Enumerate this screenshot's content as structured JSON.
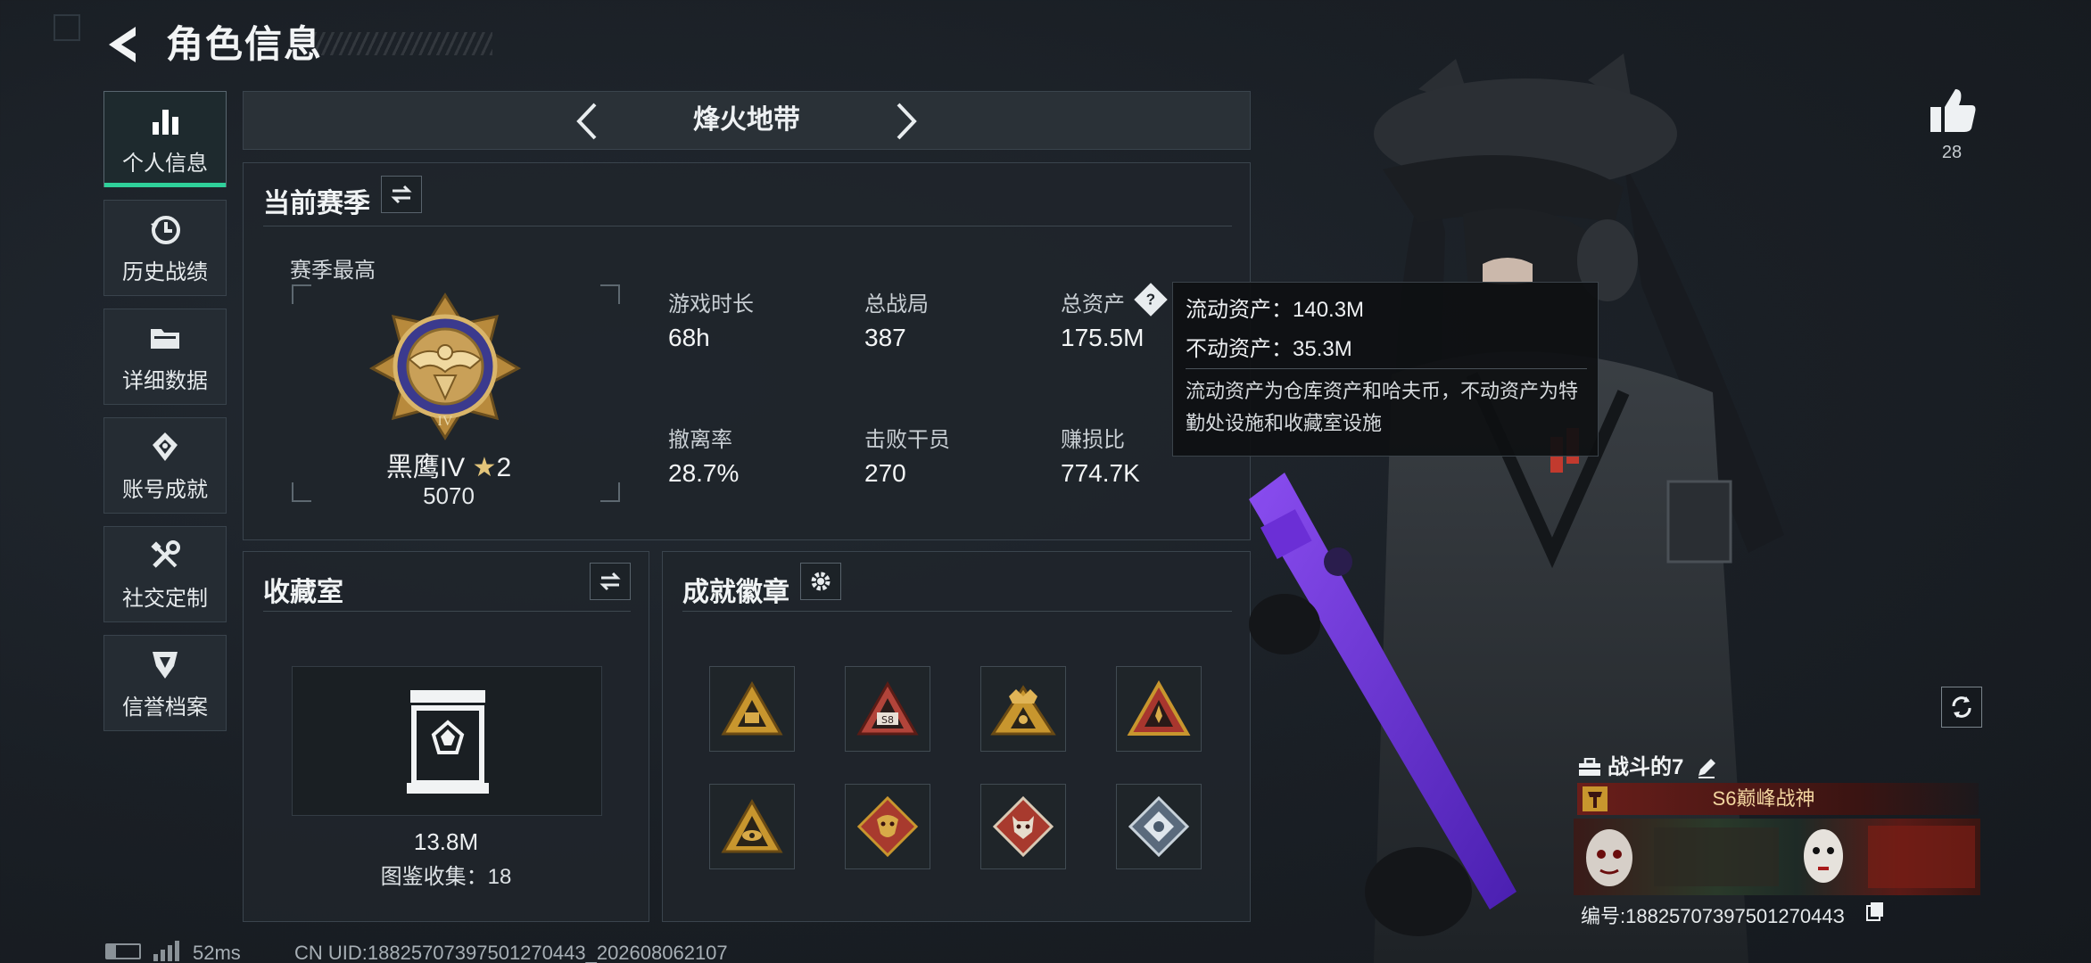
{
  "header": {
    "title": "角色信息"
  },
  "sidebar": {
    "items": [
      {
        "label": "个人信息",
        "icon": "bar-chart-icon",
        "active": true
      },
      {
        "label": "历史战绩",
        "icon": "history-clock-icon"
      },
      {
        "label": "详细数据",
        "icon": "folder-icon"
      },
      {
        "label": "账号成就",
        "icon": "achievement-icon"
      },
      {
        "label": "社交定制",
        "icon": "tools-icon"
      },
      {
        "label": "信誉档案",
        "icon": "credit-shield-icon"
      }
    ]
  },
  "mode": {
    "title": "烽火地带"
  },
  "season": {
    "title": "当前赛季",
    "best_label": "赛季最高",
    "rank_name": "黑鹰IV",
    "rank_star": "★",
    "rank_stars": "2",
    "rank_score": "5070",
    "stats": [
      {
        "label": "游戏时长",
        "value": "68h"
      },
      {
        "label": "总战局",
        "value": "387"
      },
      {
        "label": "总资产",
        "value": "175.5M"
      },
      {
        "label": "撤离率",
        "value": "28.7%"
      },
      {
        "label": "击败干员",
        "value": "270"
      },
      {
        "label": "赚损比",
        "value": "774.7K"
      }
    ],
    "help_icon": "?"
  },
  "tooltip": {
    "liquid": "流动资产：140.3M",
    "fixed": "不动资产：35.3M",
    "description": "流动资产为仓库资产和哈夫币，不动资产为特勤处设施和收藏室设施"
  },
  "collection": {
    "title": "收藏室",
    "value": "13.8M",
    "catalog": "图鉴收集：18"
  },
  "achievements": {
    "title": "成就徽章",
    "badges": [
      {
        "icon": "triangle-badge-icon",
        "color": "#c8962e"
      },
      {
        "icon": "s8-triangle-badge-icon",
        "text": "S8",
        "color": "#b2443a"
      },
      {
        "icon": "crown-triangle-badge-icon",
        "color": "#c8962e"
      },
      {
        "icon": "red-triangle-badge-icon",
        "color": "#a8362e"
      },
      {
        "icon": "eye-triangle-badge-icon",
        "color": "#c8962e"
      },
      {
        "icon": "dragon-diamond-badge-icon",
        "color": "#a83a2e"
      },
      {
        "icon": "wolf-diamond-badge-icon",
        "color": "#a83a2e"
      },
      {
        "icon": "silver-diamond-badge-icon",
        "color": "#8c9aa6"
      }
    ]
  },
  "likes": {
    "count": "28"
  },
  "player": {
    "name": "战斗的7",
    "title_badge": "S6巅峰战神",
    "id_label": "编号:1882570739750127044З"
  },
  "footer": {
    "ping": "52ms",
    "uid": "CN UID:18825707397501270443_202608062107"
  },
  "colors": {
    "accent": "#2fd09a",
    "panel": "#1f252b",
    "purple_gun": "#6b2fd6"
  }
}
